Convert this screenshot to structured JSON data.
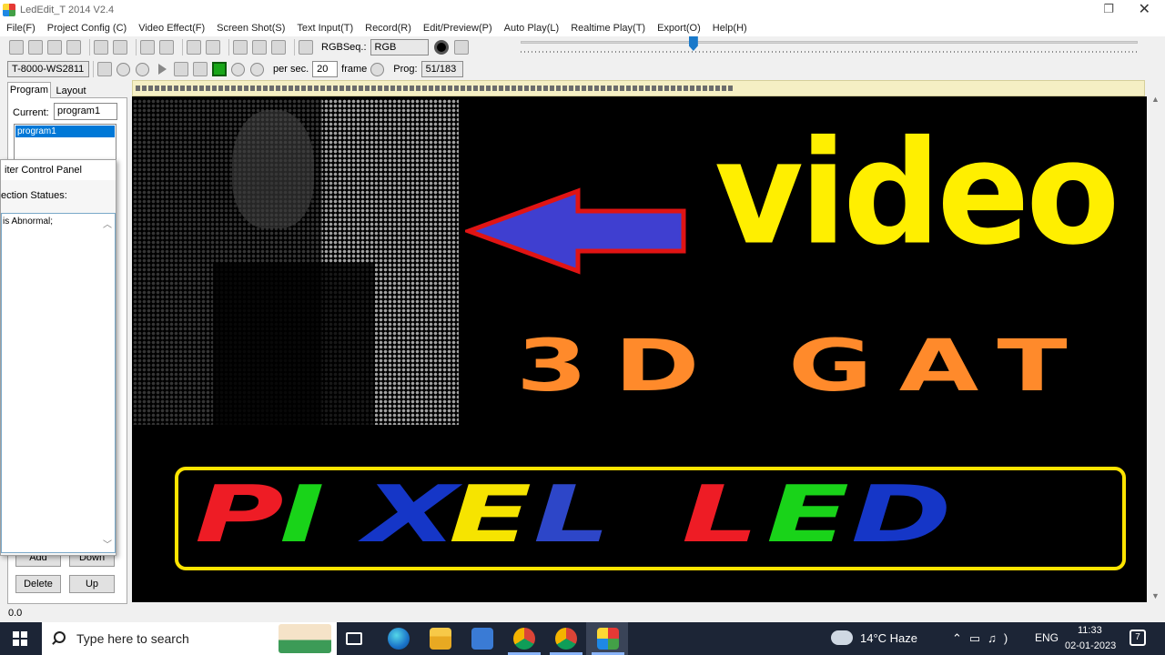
{
  "window": {
    "title": "LedEdit_T 2014 V2.4"
  },
  "menu": [
    "File(F)",
    "Project Config (C)",
    "Video Effect(F)",
    "Screen Shot(S)",
    "Text Input(T)",
    "Record(R)",
    "Edit/Preview(P)",
    "Auto Play(L)",
    "Realtime Play(T)",
    "Export(O)",
    "Help(H)"
  ],
  "toolbar": {
    "rgbseq_label": "RGBSeq.:",
    "rgbseq_value": "RGB",
    "controller": "T-8000-WS2811",
    "per_sec_label": "per sec.",
    "fps_value": "20",
    "frame_label": "frame",
    "prog_label": "Prog:",
    "prog_value": "51/183"
  },
  "slider": {
    "position_fraction": 0.28
  },
  "left_panel": {
    "tabs": [
      "Program",
      "Layout"
    ],
    "current_label": "Current:",
    "current_value": "program1",
    "programs": [
      "program1"
    ],
    "buttons": {
      "add": "Add",
      "down": "Down",
      "delete": "Delete",
      "up": "Up"
    }
  },
  "control_panel": {
    "title": "iter Control Panel",
    "status_label": "ection Statues:",
    "log": "is Abnormal;"
  },
  "canvas": {
    "line1": "video",
    "line2": "3D GAT",
    "line3_words": [
      "PIXEL",
      "LED"
    ],
    "pixel_colors": [
      "#ee1c25",
      "#19d319",
      "#1536c7",
      "#f6e400",
      "#2d46c8"
    ],
    "led_colors": [
      "#ee1c25",
      "#19d319",
      "#1536c7"
    ],
    "accent_yellow": "#ffef00",
    "accent_orange": "#ff8a2b"
  },
  "status": {
    "text": "0.0"
  },
  "taskbar": {
    "search_placeholder": "Type here to search",
    "weather": "14°C  Haze",
    "language": "ENG",
    "time": "11:33",
    "date": "02-01-2023",
    "notifications": "7"
  }
}
